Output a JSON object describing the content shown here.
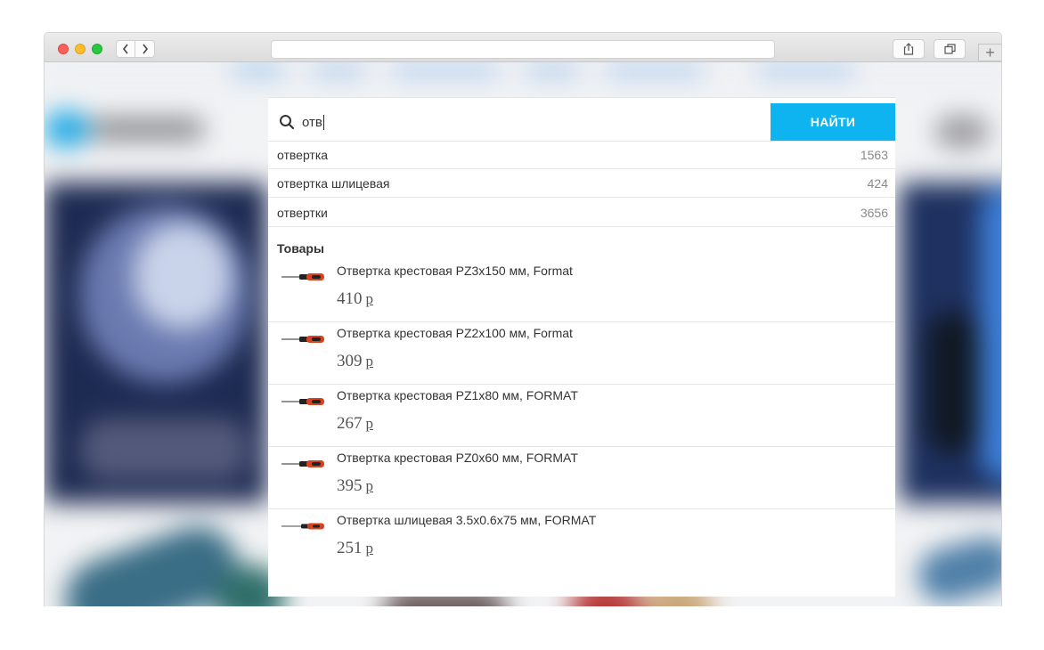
{
  "search": {
    "query": "отв",
    "button_label": "НАЙТИ"
  },
  "suggestions": [
    {
      "text": "отвертка",
      "count": "1563"
    },
    {
      "text": "отвертка шлицевая",
      "count": "424"
    },
    {
      "text": "отвертки",
      "count": "3656"
    }
  ],
  "products_section_title": "Товары",
  "currency_symbol": "р",
  "products": [
    {
      "name": "Отвертка крестовая PZ3x150 мм, Format",
      "price": "410"
    },
    {
      "name": "Отвертка крестовая PZ2x100 мм, Format",
      "price": "309"
    },
    {
      "name": "Отвертка крестовая PZ1x80 мм, FORMAT",
      "price": "267"
    },
    {
      "name": "Отвертка крестовая PZ0x60 мм, FORMAT",
      "price": "395"
    },
    {
      "name": "Отвертка шлицевая 3.5x0.6x75 мм, FORMAT",
      "price": "251"
    }
  ],
  "colors": {
    "accent": "#0db4ef",
    "traffic_red": "#fc5f57",
    "traffic_yellow": "#fdbc2e",
    "traffic_green": "#28c840"
  },
  "icons": [
    "search-icon",
    "share-icon",
    "tabs-icon",
    "chevron-left-icon",
    "chevron-right-icon",
    "plus-icon"
  ]
}
